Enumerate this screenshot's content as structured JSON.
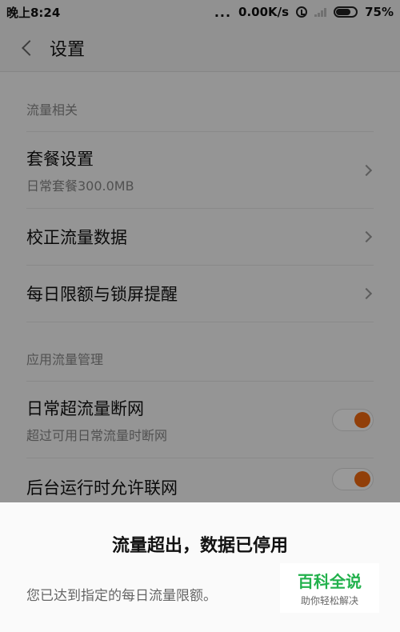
{
  "status_bar": {
    "time": "晚上8:24",
    "dots": "...",
    "speed": "0.00K/s",
    "battery": "75%",
    "battery_level": 0.75
  },
  "header": {
    "title": "设置"
  },
  "sections": {
    "data": {
      "title": "流量相关"
    },
    "apps": {
      "title": "应用流量管理"
    }
  },
  "rows": {
    "plan": {
      "label": "套餐设置",
      "sub": "日常套餐300.0MB"
    },
    "calibrate": {
      "label": "校正流量数据"
    },
    "daily": {
      "label": "每日限额与锁屏提醒"
    },
    "cutoff": {
      "label": "日常超流量断网",
      "sub": "超过可用日常流量时断网"
    },
    "background": {
      "label": "后台运行时允许联网"
    }
  },
  "toggles": {
    "cutoff_on": true,
    "background_on": true,
    "accent": "#f26a10"
  },
  "dialog": {
    "title": "流量超出，数据已停用",
    "message": "您已达到指定的每日流量限额。"
  },
  "watermark": {
    "main": "百科全说",
    "sub": "助你轻松解决"
  }
}
